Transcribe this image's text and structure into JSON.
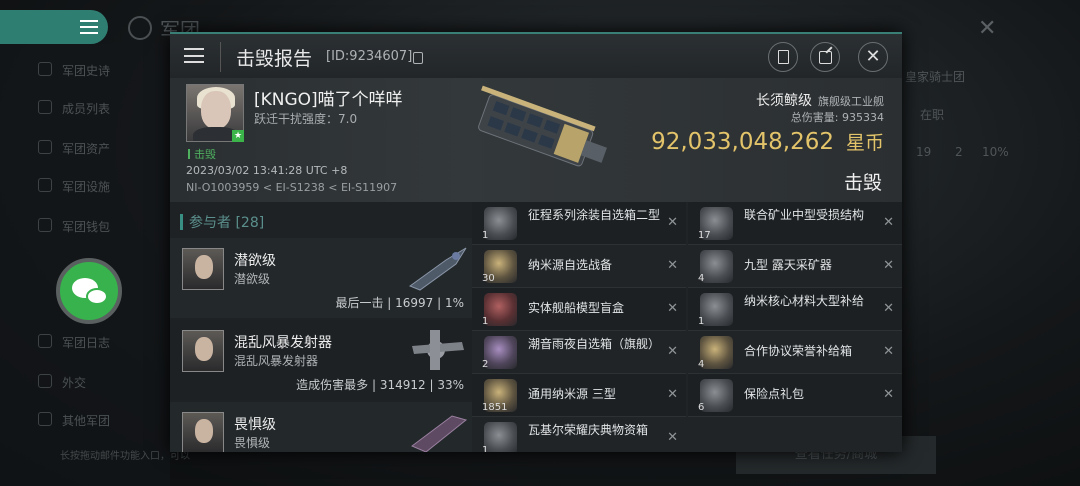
{
  "background": {
    "app_title": "军团",
    "sidebar_items": [
      "军团史诗",
      "成员列表",
      "军团资产",
      "军团设施",
      "军团钱包",
      "",
      "",
      "军团日志",
      "外交",
      "其他军团"
    ],
    "right_texts": [
      "皇家骑士团",
      "在职",
      "19",
      "2",
      "10%"
    ],
    "bottom_hint": "长按拖动邮件功能入口，可以",
    "bottom_button": "查看任务/商城"
  },
  "header": {
    "title": "击毁报告",
    "id_text": "[ID:9234607]"
  },
  "victim": {
    "name": "[KNGO]喵了个咩咩",
    "warp_disrupt": "跃迁干扰强度：7.0",
    "kill_tag": "击毁",
    "time": "2023/03/02 13:41:28 UTC +8",
    "location": "NI-O1003959 < EI-S1238 < EI-S11907",
    "ship_name": "长须鲸级",
    "ship_class": "旗舰级工业舰",
    "damage_label": "总伤害量:",
    "damage_value": "935334",
    "isk_value": "92,033,048,262",
    "isk_unit": "星币",
    "result": "击毁"
  },
  "participants": {
    "header": "参与者 [28]",
    "rows": [
      {
        "name": "潜欲级",
        "ship": "潜欲级",
        "stat": "最后一击 | 16997 | 1%"
      },
      {
        "name": "混乱风暴发射器",
        "ship": "混乱风暴发射器",
        "stat": "造成伤害最多 | 314912 | 33%"
      },
      {
        "name": "畏惧级",
        "ship": "畏惧级",
        "stat": ""
      }
    ]
  },
  "items_left": [
    {
      "qty": "1",
      "name": "征程系列涂装自选箱二型",
      "icon": "crate-icon",
      "x": "✕"
    },
    {
      "qty": "30",
      "name": "纳米源自选战备",
      "icon": "nanite-icon",
      "x": "✕"
    },
    {
      "qty": "1",
      "name": "实体舰船模型盲盒",
      "icon": "model-box-icon",
      "x": "✕"
    },
    {
      "qty": "2",
      "name": "潮音雨夜自选箱（旗舰）",
      "icon": "skin-box-icon",
      "x": "✕"
    },
    {
      "qty": "1851",
      "name": "通用纳米源 三型",
      "icon": "nanite-icon",
      "x": "✕"
    },
    {
      "qty": "1",
      "name": "瓦基尔荣耀庆典物资箱",
      "icon": "gift-crate-icon",
      "x": "✕"
    }
  ],
  "items_right": [
    {
      "qty": "17",
      "name": "联合矿业中型受损结构",
      "icon": "structure-icon",
      "x": "✕"
    },
    {
      "qty": "4",
      "name": "九型 露天采矿器",
      "icon": "miner-icon",
      "x": "✕"
    },
    {
      "qty": "1",
      "name": "纳米核心材料大型补给",
      "icon": "supply-crate-icon",
      "x": "✕"
    },
    {
      "qty": "4",
      "name": "合作协议荣誉补给箱",
      "icon": "honor-crate-icon",
      "x": "✕"
    },
    {
      "qty": "6",
      "name": "保险点礼包",
      "icon": "insurance-gift-icon",
      "x": "✕"
    }
  ]
}
